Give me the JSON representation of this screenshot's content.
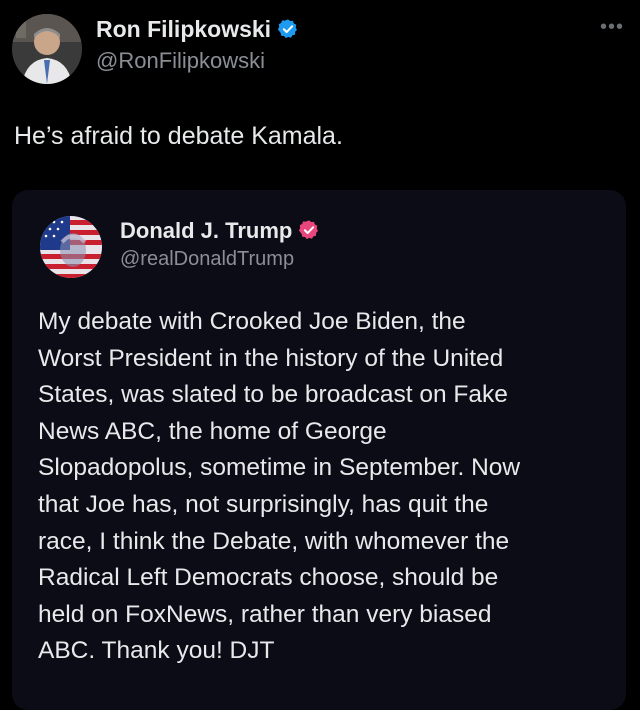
{
  "post": {
    "author": {
      "name": "Ron Filipkowski",
      "handle": "@RonFilipkowski",
      "verified_badge_color": "#1d9bf0"
    },
    "more_icon": "more-horizontal-icon",
    "text": "He’s afraid to debate Kamala.",
    "quoted_post": {
      "author": {
        "name": "Donald J. Trump",
        "handle": "@realDonaldTrump",
        "verified_badge_color": "#e8467c"
      },
      "text_lines": [
        "My debate with Crooked Joe Biden, the",
        "Worst President in the history of the United",
        "States, was slated to be broadcast on Fake",
        "News ABC, the home of George",
        "Slopadopolus, sometime in September. Now",
        "that Joe has, not surprisingly, has quit the",
        "race, I think the Debate, with whomever the",
        "Radical Left Democrats choose, should be",
        "held on FoxNews, rather than very biased",
        "ABC. Thank you! DJT"
      ]
    }
  },
  "colors": {
    "background": "#000000",
    "card_background": "#0b0c16",
    "primary_text": "#e7e9ea",
    "secondary_text": "#8b8f94"
  }
}
